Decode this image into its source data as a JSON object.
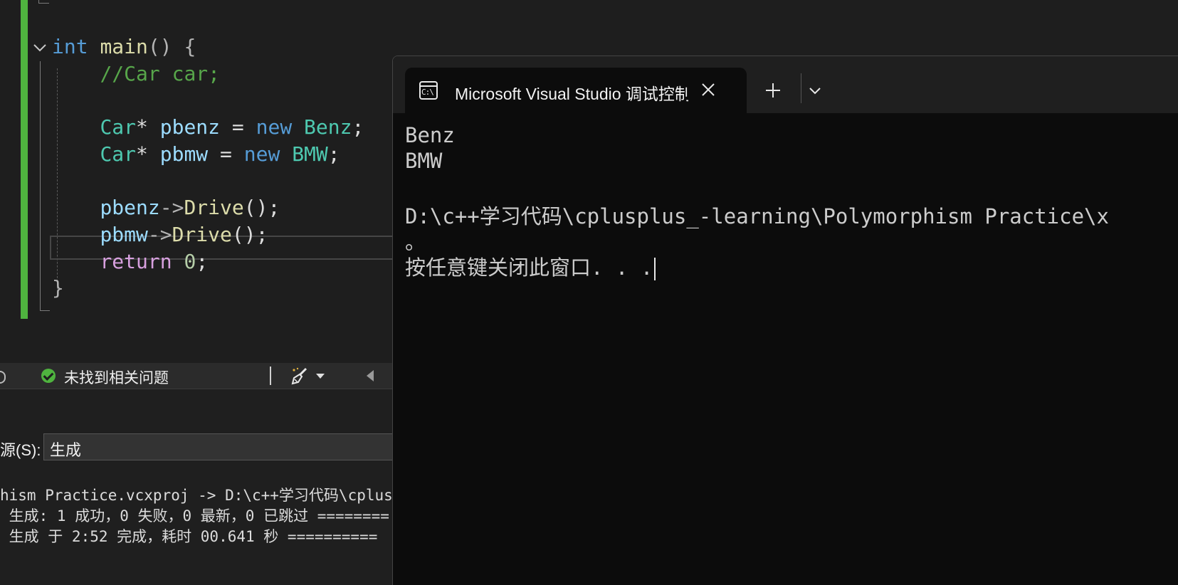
{
  "editor": {
    "lines": [
      {
        "tokens": [
          {
            "t": "int",
            "c": "kw"
          },
          {
            "t": " "
          },
          {
            "t": "main",
            "c": "fn"
          },
          {
            "t": "() ",
            "c": "p"
          },
          {
            "t": "{",
            "c": "p"
          }
        ]
      },
      {
        "tokens": [
          {
            "t": "    "
          },
          {
            "t": "//Car car;",
            "c": "cm"
          }
        ]
      },
      {
        "tokens": []
      },
      {
        "tokens": [
          {
            "t": "    "
          },
          {
            "t": "Car",
            "c": "type"
          },
          {
            "t": "* "
          },
          {
            "t": "pbenz",
            "c": "var"
          },
          {
            "t": " = "
          },
          {
            "t": "new",
            "c": "kw"
          },
          {
            "t": " "
          },
          {
            "t": "Benz",
            "c": "type"
          },
          {
            "t": ";"
          }
        ]
      },
      {
        "tokens": [
          {
            "t": "    "
          },
          {
            "t": "Car",
            "c": "type"
          },
          {
            "t": "* "
          },
          {
            "t": "pbmw",
            "c": "var"
          },
          {
            "t": " = "
          },
          {
            "t": "new",
            "c": "kw"
          },
          {
            "t": " "
          },
          {
            "t": "BMW",
            "c": "type"
          },
          {
            "t": ";"
          }
        ]
      },
      {
        "tokens": []
      },
      {
        "tokens": [
          {
            "t": "    "
          },
          {
            "t": "pbenz",
            "c": "var"
          },
          {
            "t": "->",
            "c": "p"
          },
          {
            "t": "Drive",
            "c": "fn"
          },
          {
            "t": "();"
          }
        ]
      },
      {
        "tokens": [
          {
            "t": "    "
          },
          {
            "t": "pbmw",
            "c": "var"
          },
          {
            "t": "->",
            "c": "p"
          },
          {
            "t": "Drive",
            "c": "fn"
          },
          {
            "t": "();"
          }
        ]
      },
      {
        "tokens": [
          {
            "t": "    "
          },
          {
            "t": "return",
            "c": "ctl"
          },
          {
            "t": " "
          },
          {
            "t": "0",
            "c": "num"
          },
          {
            "t": ";"
          }
        ]
      },
      {
        "tokens": [
          {
            "t": "}",
            "c": "p"
          }
        ]
      }
    ]
  },
  "status_bar": {
    "issues_text": "未找到相关问题"
  },
  "output": {
    "source_label": "源(S):",
    "source_value": "生成",
    "lines": [
      "hism Practice.vcxproj -> D:\\c++学习代码\\cplusp",
      " 生成: 1 成功，0 失败，0 最新，0 已跳过 ========",
      " 生成 于 2:52 完成，耗时 00.641 秒 =========="
    ]
  },
  "terminal": {
    "tab_title": "Microsoft Visual Studio 调试控制台",
    "icon_text": "C:\\",
    "lines": [
      "Benz",
      "BMW",
      "",
      "D:\\c++学习代码\\cplusplus_-learning\\Polymorphism Practice\\x",
      "。",
      "按任意键关闭此窗口. . ."
    ]
  },
  "icons": {
    "fold": "chevron-down-icon",
    "status": "check-circle-icon",
    "cleanup": "brush-icon",
    "scroll": "caret-left-icon",
    "terminal": "cmd-icon",
    "close": "close-icon",
    "new_tab": "plus-icon",
    "menu": "chevron-down-icon"
  }
}
